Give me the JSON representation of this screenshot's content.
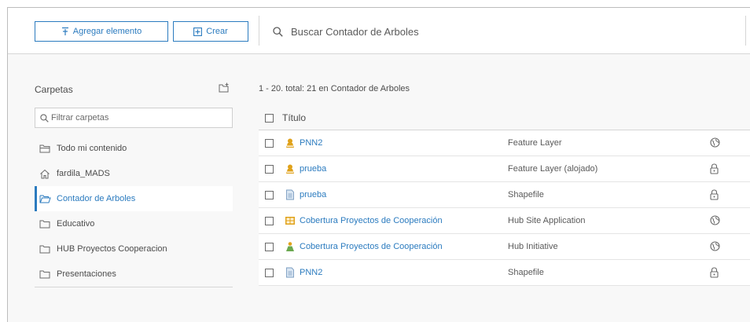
{
  "toolbar": {
    "add_item_label": "Agregar elemento",
    "create_label": "Crear",
    "search_placeholder": "Buscar Contador de Arboles"
  },
  "sidebar": {
    "title": "Carpetas",
    "filter_placeholder": "Filtrar carpetas",
    "folders": [
      {
        "label": "Todo mi contenido",
        "icon": "folders-icon",
        "active": false
      },
      {
        "label": "fardila_MADS",
        "icon": "home-icon",
        "active": false
      },
      {
        "label": "Contador de Arboles",
        "icon": "folder-open-icon",
        "active": true
      },
      {
        "label": "Educativo",
        "icon": "folder-icon",
        "active": false
      },
      {
        "label": "HUB Proyectos Cooperacion",
        "icon": "folder-icon",
        "active": false
      },
      {
        "label": "Presentaciones",
        "icon": "folder-icon",
        "active": false
      }
    ]
  },
  "content": {
    "count_text": "1 - 20. total: 21 en Contador de Arboles",
    "column_title": "Título",
    "items": [
      {
        "title": "PNN2",
        "type": "Feature Layer",
        "icon": "feature-layer-icon",
        "share": "globe-icon"
      },
      {
        "title": "prueba",
        "type": "Feature Layer (alojado)",
        "icon": "feature-layer-icon",
        "share": "lock-icon"
      },
      {
        "title": "prueba",
        "type": "Shapefile",
        "icon": "file-icon",
        "share": "lock-icon"
      },
      {
        "title": "Cobertura Proyectos de Cooperación",
        "type": "Hub Site Application",
        "icon": "site-app-icon",
        "share": "globe-icon"
      },
      {
        "title": "Cobertura Proyectos de Cooperación",
        "type": "Hub Initiative",
        "icon": "initiative-icon",
        "share": "globe-icon"
      },
      {
        "title": "PNN2",
        "type": "Shapefile",
        "icon": "file-icon",
        "share": "lock-icon"
      }
    ]
  },
  "colors": {
    "accent": "#2b7bbf",
    "layer_icon": "#e0a21b",
    "initiative_icon": "#6aa84f",
    "background": "#f8f8f8"
  }
}
